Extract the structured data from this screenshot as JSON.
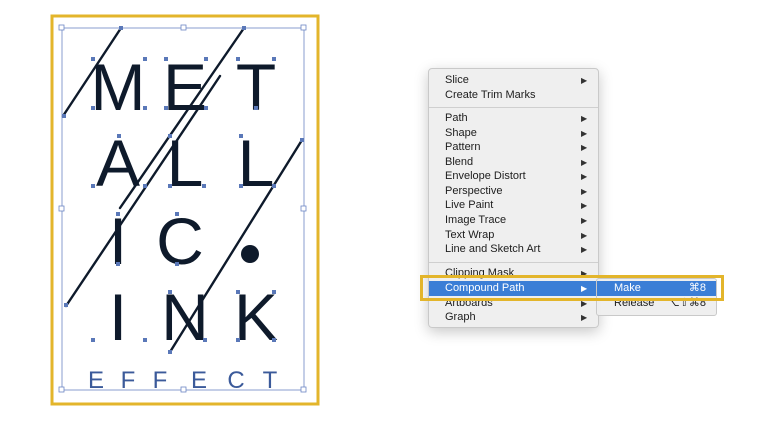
{
  "artwork": {
    "line1": [
      "M",
      "E",
      "T"
    ],
    "line2": [
      "A",
      "L",
      "L"
    ],
    "line3": [
      "I",
      "C",
      "."
    ],
    "line4": [
      "I",
      "N",
      "K"
    ],
    "subtitle": [
      "E",
      "F",
      "F",
      "E",
      "C",
      "T"
    ]
  },
  "colors": {
    "highlight": "#e3b52b",
    "selection": "#3b7ed6",
    "ink": "#0e1a2b",
    "anchor": "#5a78b8"
  },
  "menu": {
    "items": [
      {
        "label": "Slice",
        "submenu": true
      },
      {
        "label": "Create Trim Marks",
        "submenu": false
      },
      {
        "label": "Path",
        "submenu": true
      },
      {
        "label": "Shape",
        "submenu": true
      },
      {
        "label": "Pattern",
        "submenu": true
      },
      {
        "label": "Blend",
        "submenu": true
      },
      {
        "label": "Envelope Distort",
        "submenu": true
      },
      {
        "label": "Perspective",
        "submenu": true
      },
      {
        "label": "Live Paint",
        "submenu": true
      },
      {
        "label": "Image Trace",
        "submenu": true
      },
      {
        "label": "Text Wrap",
        "submenu": true
      },
      {
        "label": "Line and Sketch Art",
        "submenu": true
      },
      {
        "label": "Clipping Mask",
        "submenu": true
      },
      {
        "label": "Compound Path",
        "submenu": true,
        "selected": true
      },
      {
        "label": "Artboards",
        "submenu": true
      },
      {
        "label": "Graph",
        "submenu": true
      }
    ],
    "arrow": "▶"
  },
  "submenu": {
    "items": [
      {
        "label": "Make",
        "shortcut": "⌘8",
        "selected": true
      },
      {
        "label": "Release",
        "shortcut": "⌥⇧⌘8"
      }
    ]
  }
}
